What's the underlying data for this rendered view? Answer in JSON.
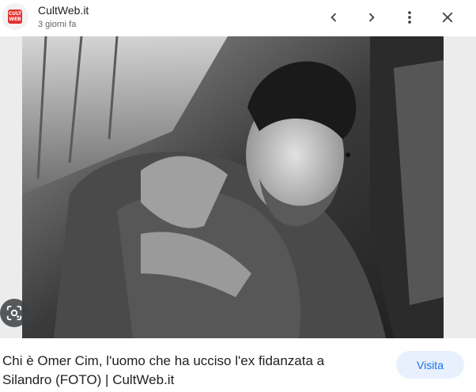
{
  "header": {
    "site_name": "CultWeb.it",
    "time_ago": "3 giorni fa",
    "favicon_text_top": "CULT",
    "favicon_text_bottom": "WEB"
  },
  "icons": {
    "back": "chevron-left-icon",
    "forward": "chevron-right-icon",
    "more": "more-vert-icon",
    "close": "close-icon",
    "lens": "google-lens-icon"
  },
  "result": {
    "title": "Chi è Omer Cim, l'uomo che ha ucciso l'ex fidanzata a Silandro (FOTO) | CultWeb.it",
    "visit_label": "Visita"
  },
  "colors": {
    "accent": "#1a73e8",
    "visit_bg": "#e8f0fe",
    "favicon": "#e3342f"
  }
}
